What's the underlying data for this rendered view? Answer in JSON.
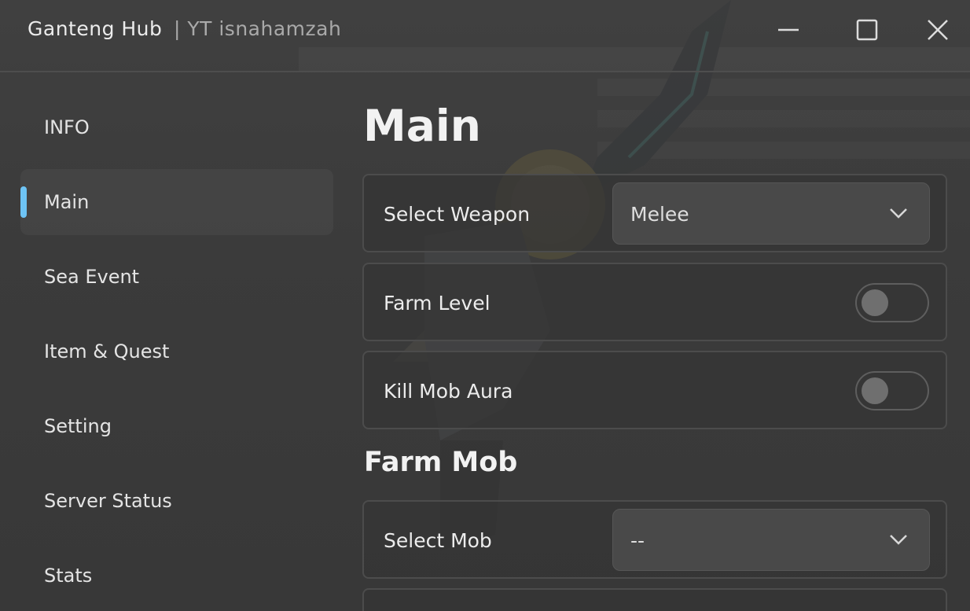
{
  "window": {
    "title": "Ganteng Hub",
    "subtitle": "| YT isnahamzah"
  },
  "controls": {
    "minimize_icon": "minimize-icon",
    "maximize_icon": "maximize-icon",
    "close_icon": "close-icon"
  },
  "sidebar": {
    "active": "Main",
    "accent_color": "#6ec4f5",
    "items": [
      {
        "label": "INFO"
      },
      {
        "label": "Main"
      },
      {
        "label": "Sea Event"
      },
      {
        "label": "Item & Quest"
      },
      {
        "label": "Setting"
      },
      {
        "label": "Server Status"
      },
      {
        "label": "Stats"
      }
    ]
  },
  "main": {
    "title": "Main",
    "select_weapon": {
      "label": "Select Weapon",
      "value": "Melee"
    },
    "farm_level": {
      "label": "Farm Level",
      "enabled": false
    },
    "kill_mob_aura": {
      "label": "Kill Mob Aura",
      "enabled": false
    },
    "farm_mob_section": {
      "title": "Farm Mob",
      "select_mob": {
        "label": "Select Mob",
        "value": "--"
      }
    }
  }
}
